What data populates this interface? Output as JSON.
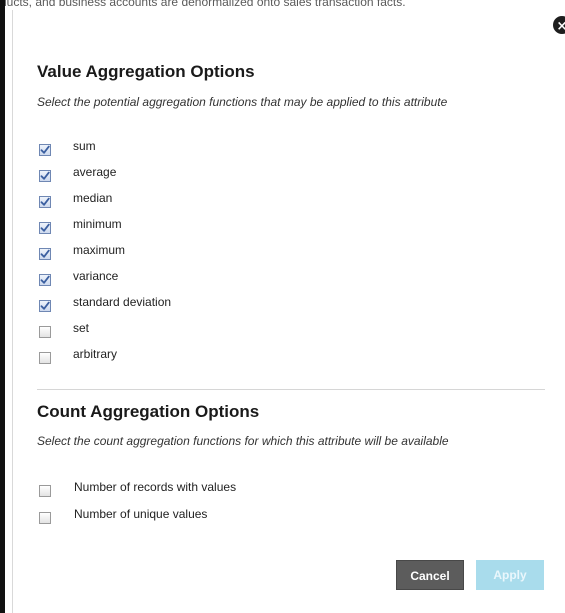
{
  "background_text": "ducts, and business accounts are denormalized onto sales transaction facts.",
  "dialog": {
    "close_glyph": "×",
    "value_section": {
      "title": "Value Aggregation Options",
      "description": "Select the potential aggregation functions that may be applied to this attribute",
      "options": [
        {
          "label": "sum",
          "checked": true
        },
        {
          "label": "average",
          "checked": true
        },
        {
          "label": "median",
          "checked": true
        },
        {
          "label": "minimum",
          "checked": true
        },
        {
          "label": "maximum",
          "checked": true
        },
        {
          "label": "variance",
          "checked": true
        },
        {
          "label": "standard deviation",
          "checked": true
        },
        {
          "label": "set",
          "checked": false
        },
        {
          "label": "arbitrary",
          "checked": false
        }
      ]
    },
    "count_section": {
      "title": "Count Aggregation Options",
      "description": "Select the count aggregation functions for which this attribute will be available",
      "options": [
        {
          "label": "Number of records with values",
          "checked": false
        },
        {
          "label": "Number of unique values",
          "checked": false
        }
      ]
    },
    "buttons": {
      "cancel_label": "Cancel",
      "apply_label": "Apply",
      "apply_enabled": false
    }
  },
  "colors": {
    "cancel_button": "#5c5c5c",
    "apply_button_disabled": "#a9dcec",
    "checkbox_checked": "#3b5fa0"
  }
}
